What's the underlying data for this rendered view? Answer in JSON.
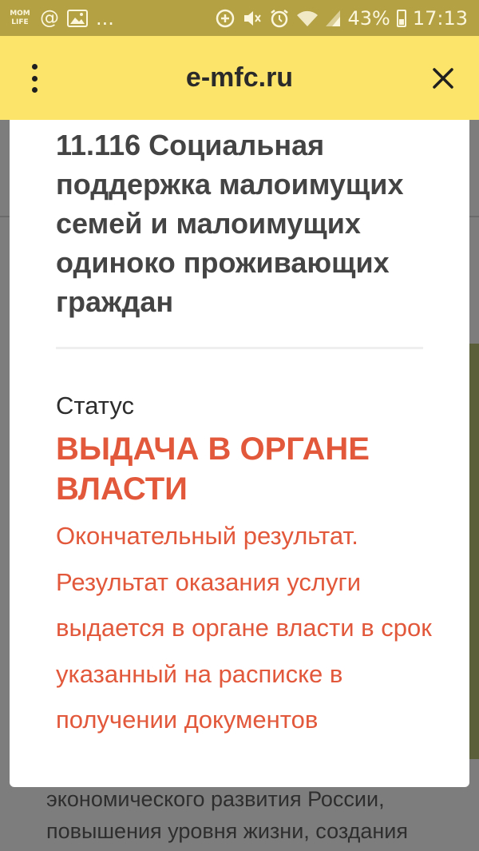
{
  "status_bar": {
    "battery": "43%",
    "time": "17:13",
    "more": "...",
    "app_badge_line1": "MOM",
    "app_badge_line2": "LIFE"
  },
  "toolbar": {
    "site": "e-mfc.ru"
  },
  "background_page": {
    "lines": [
      "экономического развития России,",
      "повышения уровня жизни, создания"
    ]
  },
  "modal": {
    "service_title": "11.116 Социальная поддержка малоимущих семей и малоимущих одиноко проживающих граждан",
    "status_label": "Статус",
    "status_value": "ВЫДАЧА В ОРГАНЕ ВЛАСТИ",
    "status_description": "Окончательный результат. Результат оказания услуги выдается в органе власти в срок указанный на расписке в получении документов"
  },
  "colors": {
    "toolbar": "#fce36a",
    "status_bar": "#b3a144",
    "accent_status": "#e2583b",
    "title_text": "#444444"
  },
  "icons": [
    "at-icon",
    "image-icon",
    "data-saver-icon",
    "mute-icon",
    "alarm-icon",
    "wifi-icon",
    "signal-icon",
    "battery-icon",
    "menu-dots-icon",
    "close-icon"
  ]
}
